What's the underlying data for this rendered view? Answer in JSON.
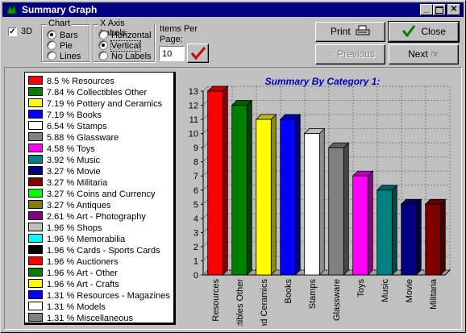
{
  "window": {
    "title": "Summary Graph"
  },
  "options": {
    "three_d_label": "3D",
    "three_d_checked": true,
    "chart_group_label": "Chart",
    "chart_types": [
      "Bars",
      "Pie",
      "Lines"
    ],
    "chart_selected": "Bars",
    "x_axis_group_label": "X Axis Labels",
    "x_axis_options": [
      "Horizontal",
      "Vertical",
      "No Labels"
    ],
    "x_axis_selected": "Vertical",
    "items_per_page_label_line1": "Items Per",
    "items_per_page_label_line2": "Page:",
    "items_per_page_value": "10"
  },
  "buttons": {
    "print": "Print",
    "close": "Close",
    "previous": "Previous",
    "next": "Next"
  },
  "colors": {
    "title_bar": "#000080",
    "chart_title": "#0000c0",
    "close_check": "#008000"
  },
  "legend": [
    {
      "text": "8.5 % Resources",
      "color": "#ff0000"
    },
    {
      "text": "7.84 % Collectibles Other",
      "color": "#008000"
    },
    {
      "text": "7.19 % Pottery and Ceramics",
      "color": "#ffff00"
    },
    {
      "text": "7.19 % Books",
      "color": "#0000ff"
    },
    {
      "text": "6.54 % Stamps",
      "color": "#ffffff"
    },
    {
      "text": "5.88 % Glassware",
      "color": "#808080"
    },
    {
      "text": "4.58 % Toys",
      "color": "#ff00ff"
    },
    {
      "text": "3.92 % Music",
      "color": "#008080"
    },
    {
      "text": "3.27 % Movie",
      "color": "#000080"
    },
    {
      "text": "3.27 % Militaria",
      "color": "#800000"
    },
    {
      "text": "3.27 % Coins and Currency",
      "color": "#00ff00"
    },
    {
      "text": "3.27 % Antiques",
      "color": "#808000"
    },
    {
      "text": "2.61 % Art - Photography",
      "color": "#800080"
    },
    {
      "text": "1.96 % Shops",
      "color": "#c0c0c0"
    },
    {
      "text": "1.96 % Memorabilia",
      "color": "#00ffff"
    },
    {
      "text": "1.96 % Cards - Sports Cards",
      "color": "#000000"
    },
    {
      "text": "1.96 % Auctioners",
      "color": "#ff0000"
    },
    {
      "text": "1.96 % Art - Other",
      "color": "#008000"
    },
    {
      "text": "1.96 % Art - Crafts",
      "color": "#ffff00"
    },
    {
      "text": "1.31 % Resources - Magazines",
      "color": "#0000ff"
    },
    {
      "text": "1.31 % Models",
      "color": "#ffffff"
    },
    {
      "text": "1.31 % Miscellaneous",
      "color": "#808080"
    }
  ],
  "chart_data": {
    "type": "bar",
    "title": "Summary By Category 1:",
    "categories": [
      "Resources",
      "Collectibles Other",
      "Pottery and Ceramics",
      "Books",
      "Stamps",
      "Glassware",
      "Toys",
      "Music",
      "Movie",
      "Militaria"
    ],
    "tick_labels": [
      "Resources",
      "ctibles Other",
      "nd Ceramics",
      "Books",
      "Stamps",
      "Glassware",
      "Toys",
      "Music",
      "Movie",
      "Militaria"
    ],
    "values": [
      13,
      12,
      11,
      11,
      10,
      9,
      7,
      6,
      5,
      5
    ],
    "colors": [
      "#ff0000",
      "#008000",
      "#ffff00",
      "#0000ff",
      "#ffffff",
      "#808080",
      "#ff00ff",
      "#008080",
      "#000080",
      "#800000"
    ],
    "ylim": [
      0,
      13
    ],
    "yticks": [
      0,
      1,
      2,
      3,
      4,
      5,
      6,
      7,
      8,
      9,
      10,
      11,
      12,
      13
    ],
    "grid": true,
    "three_d": true,
    "x_label_orientation": "vertical"
  }
}
